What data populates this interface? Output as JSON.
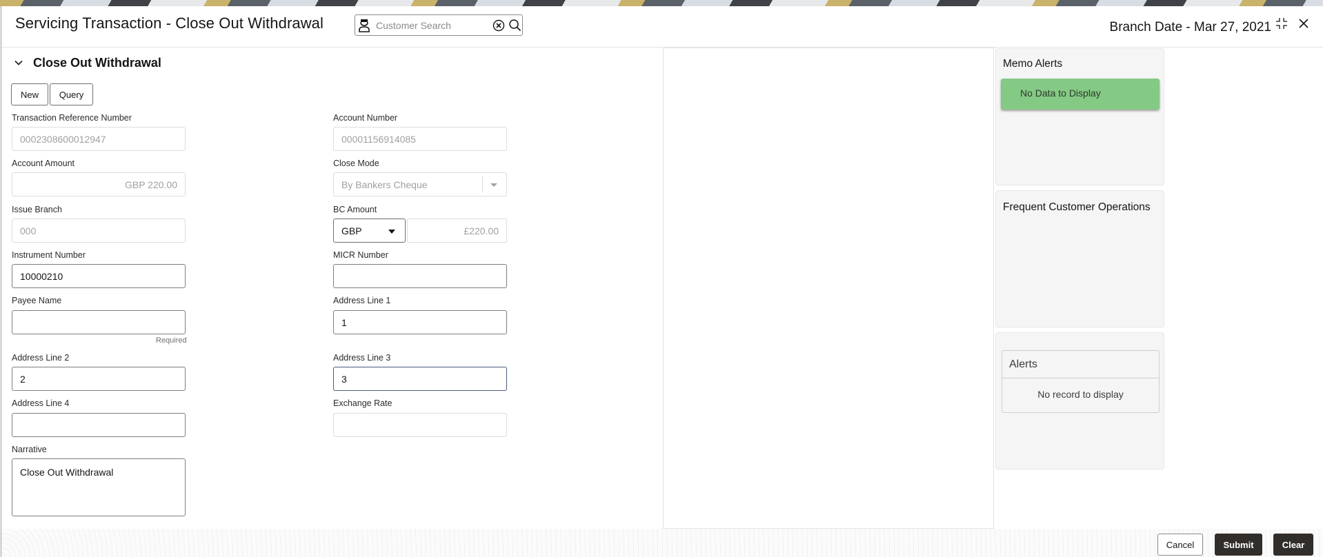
{
  "header": {
    "title": "Servicing Transaction - Close Out Withdrawal",
    "search": {
      "placeholder": "Customer Search",
      "value": ""
    },
    "branch_date": "Branch Date - Mar 27, 2021"
  },
  "section": {
    "title": "Close Out Withdrawal",
    "buttons": {
      "new": "New",
      "query": "Query"
    }
  },
  "form": {
    "transaction_reference_number": {
      "label": "Transaction Reference Number",
      "value": "0002308600012947"
    },
    "account_number": {
      "label": "Account Number",
      "value": "00001156914085"
    },
    "account_amount": {
      "label": "Account Amount",
      "value": "GBP 220.00"
    },
    "close_mode": {
      "label": "Close Mode",
      "value": "By Bankers Cheque"
    },
    "issue_branch": {
      "label": "Issue Branch",
      "value": "000"
    },
    "bc_amount": {
      "label": "BC Amount",
      "currency": "GBP",
      "value": "£220.00"
    },
    "instrument_number": {
      "label": "Instrument Number",
      "value": "10000210"
    },
    "micr_number": {
      "label": "MICR Number",
      "value": ""
    },
    "payee_name": {
      "label": "Payee Name",
      "value": "",
      "hint": "Required"
    },
    "address_line_1": {
      "label": "Address Line 1",
      "value": "1"
    },
    "address_line_2": {
      "label": "Address Line 2",
      "value": "2"
    },
    "address_line_3": {
      "label": "Address Line 3",
      "value": "3"
    },
    "address_line_4": {
      "label": "Address Line 4",
      "value": ""
    },
    "exchange_rate": {
      "label": "Exchange Rate",
      "value": ""
    },
    "narrative": {
      "label": "Narrative",
      "value": "Close Out Withdrawal"
    }
  },
  "side_panels": {
    "memo_alerts": {
      "title": "Memo Alerts",
      "message": "No Data to Display"
    },
    "frequent_ops": {
      "title": "Frequent Customer Operations"
    },
    "alerts": {
      "title": "Alerts",
      "message": "No record to display"
    }
  },
  "footer": {
    "cancel": "Cancel",
    "submit": "Submit",
    "clear": "Clear"
  },
  "colors": {
    "memo_banner": "#84c984",
    "primary_button": "#312d2a"
  }
}
